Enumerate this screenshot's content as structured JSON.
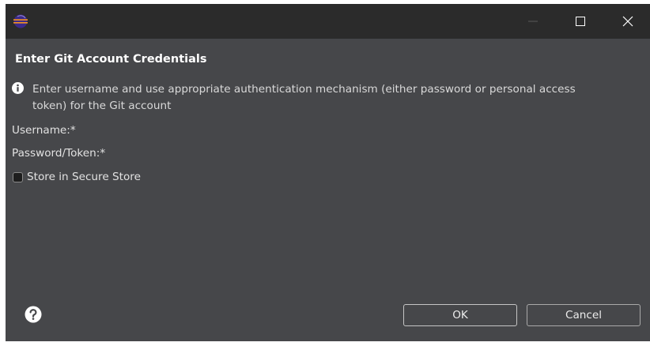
{
  "window": {
    "title": "",
    "controls": {
      "minimize_icon": "minimize-icon",
      "maximize_icon": "maximize-icon",
      "close_icon": "close-icon"
    }
  },
  "dialog": {
    "title": "Enter Git Account Credentials",
    "info_message": "Enter username and use appropriate authentication mechanism (either password or personal access token) for the Git account",
    "username_label": "Username:*",
    "password_label": "Password/Token:*",
    "store_label": "Store in Secure Store",
    "store_checked": false
  },
  "buttons": {
    "ok": "OK",
    "cancel": "Cancel"
  },
  "colors": {
    "background": "#46474a",
    "titlebar": "#2b2b2b",
    "text": "#e2e2e2",
    "info_icon": "#ffffff"
  }
}
